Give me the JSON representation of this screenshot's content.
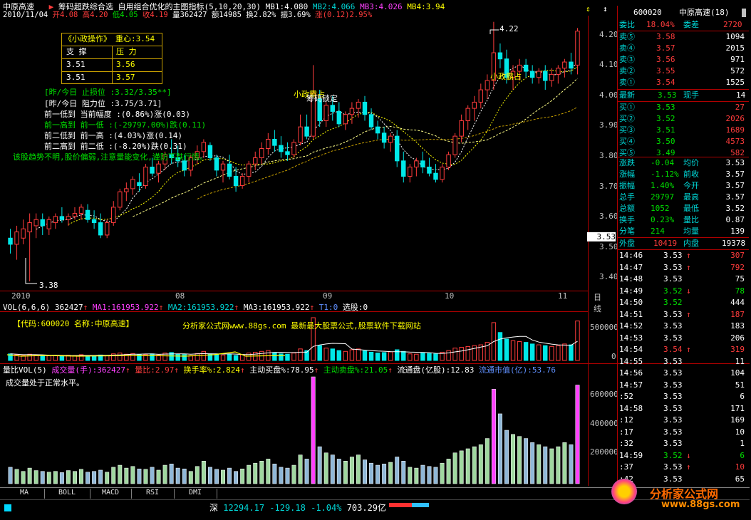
{
  "header": {
    "stock_name": "中原高速",
    "arrow": "▶",
    "formula_title": "筹码超跌综合选 自用组合优化的主图指标(5,10,20,30)",
    "mb1": "MB1:4.080",
    "mb2": "MB2:4.066",
    "mb3": "MB3:4.026",
    "mb4": "MB4:3.94",
    "date": "2010/11/04",
    "open": "开4.08",
    "high": "高4.20",
    "low": "低4.05",
    "close": "收4.19",
    "volume": "量362427",
    "amount": "额14985",
    "turnover": "换2.82%",
    "amplitude": "振3.69%",
    "change": "涨(0.12)2.95%"
  },
  "info_box": {
    "title": "《小政操作》",
    "center": "重心:3.54",
    "support_label": "支 撑",
    "pressure_label": "压 力",
    "support_1": "3.51",
    "pressure_1": "3.56",
    "support_2": "3.51",
    "pressure_2": "3.57"
  },
  "notes": {
    "stop_line": "[昨/今日 止损位 :3.32/3.35**]",
    "resist_line": "[昨/今日 阻力位 :3.75/3.71]",
    "l1": "前一低到 当前幅度 :(0.86%)涨(0.03)",
    "l2": "前一高到 前一低 :(-29797.00%)跌(0.11)",
    "l3": "前二低到 前一高 :(4.03%)涨(0.14)",
    "l4": "前二高到 前二低 :(-8.20%)跌(0.31)",
    "summary": "该股趋势不明,股价偏弱,注意量能变化,谨防下跌行情。",
    "tag_xiaozheng": "小政霸占",
    "tag_lock": "筹码锁定",
    "tag_xiaozheng2": "小政霸占",
    "max_price": "4.22",
    "min_price": "3.38"
  },
  "x_axis": {
    "m1": "2010",
    "m2": "08",
    "m3": "09",
    "m4": "10",
    "m5": "11",
    "period": "日线"
  },
  "y_axis": {
    "prices": [
      "4.20",
      "4.10",
      "4.00",
      "3.90",
      "3.80",
      "3.70",
      "3.60",
      "3.50",
      "3.40"
    ],
    "current": "3.53",
    "vol_ticks": [
      "500000",
      "0"
    ],
    "lb_ticks": [
      "600000",
      "400000",
      "200000"
    ]
  },
  "vol_header": {
    "name": "VOL(6,6,6)",
    "value": "362427",
    "ma1": "MA1:161953.922",
    "ma2": "MA2:161953.922",
    "ma3": "MA3:161953.922",
    "t1": "T1:0",
    "pick": "选股:0",
    "code_info": "【代码:600020 名称:中原高速】",
    "website": "分析家公式网www.88gs.com 最新最大股票公式,股票软件下载网站"
  },
  "lb_header": {
    "name": "量比VOL(5)",
    "vol": "成交量(手):362427",
    "lb": "量比:2.97",
    "hsl": "换手率%:2.824",
    "buy": "主动买盘%:78.95",
    "sell": "主动卖盘%:21.05",
    "float": "流通盘(亿股):12.83",
    "mkt": "流通市值(亿):53.76",
    "note": "成交量处于正常水平。"
  },
  "tabs": [
    "MA",
    "BOLL",
    "MACD",
    "RSI",
    "DMI"
  ],
  "status": {
    "market": "深",
    "index": "12294.17",
    "change": "-129.18",
    "pct": "-1.04%",
    "amount": "703.29亿",
    "logo_text": "分析家公式网",
    "logo_url": "www.88gs.com"
  },
  "order_book": {
    "code": "600020",
    "name": "中原高速(18)",
    "weibi_label": "委比",
    "weibi": "18.04%",
    "weicha_label": "委差",
    "weicha": "2720",
    "asks": [
      {
        "label": "卖⑤",
        "price": "3.58",
        "vol": "1094"
      },
      {
        "label": "卖④",
        "price": "3.57",
        "vol": "2015"
      },
      {
        "label": "卖③",
        "price": "3.56",
        "vol": "971"
      },
      {
        "label": "卖②",
        "price": "3.55",
        "vol": "572"
      },
      {
        "label": "卖①",
        "price": "3.54",
        "vol": "1525"
      }
    ],
    "last_label": "最新",
    "last": "3.53",
    "hand_label": "现手",
    "hand": "14",
    "bids": [
      {
        "label": "买①",
        "price": "3.53",
        "vol": "27"
      },
      {
        "label": "买②",
        "price": "3.52",
        "vol": "2026"
      },
      {
        "label": "买③",
        "price": "3.51",
        "vol": "1689"
      },
      {
        "label": "买④",
        "price": "3.50",
        "vol": "4573"
      },
      {
        "label": "买⑤",
        "price": "3.49",
        "vol": "582"
      }
    ],
    "stats": [
      {
        "l1": "涨跌",
        "v1": "-0.04",
        "l2": "均价",
        "v2": "3.53"
      },
      {
        "l1": "涨幅",
        "v1": "-1.12%",
        "l2": "前收",
        "v2": "3.57"
      },
      {
        "l1": "振幅",
        "v1": "1.40%",
        "l2": "今开",
        "v2": "3.57"
      },
      {
        "l1": "总手",
        "v1": "29797",
        "l2": "最高",
        "v2": "3.57"
      },
      {
        "l1": "总额",
        "v1": "1052",
        "l2": "最低",
        "v2": "3.52"
      },
      {
        "l1": "换手",
        "v1": "0.23%",
        "l2": "量比",
        "v2": "0.87"
      },
      {
        "l1": "分笔",
        "v1": "214",
        "l2": "均量",
        "v2": "139"
      }
    ],
    "outer_label": "外盘",
    "outer": "10419",
    "inner_label": "内盘",
    "inner": "19378",
    "ticks": [
      {
        "t": "14:46",
        "p": "3.53",
        "v": "307",
        "a": "↑"
      },
      {
        "t": "14:47",
        "p": "3.53",
        "v": "792",
        "a": "↑"
      },
      {
        "t": "14:48",
        "p": "3.53",
        "v": "75",
        "a": ""
      },
      {
        "t": "14:49",
        "p": "3.52",
        "v": "78",
        "a": "↓"
      },
      {
        "t": "14:50",
        "p": "3.52",
        "v": "444",
        "a": ""
      },
      {
        "t": "14:51",
        "p": "3.53",
        "v": "187",
        "a": "↑"
      },
      {
        "t": "14:52",
        "p": "3.53",
        "v": "183",
        "a": ""
      },
      {
        "t": "14:53",
        "p": "3.53",
        "v": "206",
        "a": ""
      },
      {
        "t": "14:54",
        "p": "3.54",
        "v": "319",
        "a": "↑"
      },
      {
        "t": "14:55",
        "p": "3.53",
        "v": "11",
        "a": ""
      },
      {
        "t": "14:56",
        "p": "3.53",
        "v": "104",
        "a": ""
      },
      {
        "t": "14:57",
        "p": "3.53",
        "v": "51",
        "a": ""
      },
      {
        "t": ":52",
        "p": "3.53",
        "v": "6",
        "a": ""
      },
      {
        "t": "14:58",
        "p": "3.53",
        "v": "171",
        "a": ""
      },
      {
        "t": ":12",
        "p": "3.53",
        "v": "169",
        "a": ""
      },
      {
        "t": ":17",
        "p": "3.53",
        "v": "10",
        "a": ""
      },
      {
        "t": ":32",
        "p": "3.53",
        "v": "1",
        "a": ""
      },
      {
        "t": "14:59",
        "p": "3.52",
        "v": "6",
        "a": "↓"
      },
      {
        "t": ":37",
        "p": "3.53",
        "v": "10",
        "a": "↑"
      },
      {
        "t": ":42",
        "p": "3.53",
        "v": "65",
        "a": ""
      }
    ]
  },
  "chart_data": {
    "type": "candlestick",
    "period": "daily",
    "ylim": [
      3.35,
      4.24
    ],
    "candles": [
      [
        3.52,
        3.55,
        3.47,
        3.5
      ],
      [
        3.5,
        3.56,
        3.45,
        3.54
      ],
      [
        3.52,
        3.58,
        3.5,
        3.55
      ],
      [
        3.54,
        3.6,
        3.38,
        3.57
      ],
      [
        3.56,
        3.6,
        3.52,
        3.58
      ],
      [
        3.58,
        3.6,
        3.53,
        3.56
      ],
      [
        3.55,
        3.59,
        3.53,
        3.58
      ],
      [
        3.57,
        3.6,
        3.55,
        3.59
      ],
      [
        3.59,
        3.62,
        3.57,
        3.58
      ],
      [
        3.58,
        3.6,
        3.56,
        3.59
      ],
      [
        3.59,
        3.62,
        3.58,
        3.6
      ],
      [
        3.6,
        3.63,
        3.58,
        3.62
      ],
      [
        3.61,
        3.63,
        3.57,
        3.58
      ],
      [
        3.58,
        3.61,
        3.55,
        3.57
      ],
      [
        3.57,
        3.6,
        3.52,
        3.53
      ],
      [
        3.53,
        3.58,
        3.52,
        3.57
      ],
      [
        3.57,
        3.64,
        3.56,
        3.62
      ],
      [
        3.62,
        3.68,
        3.61,
        3.67
      ],
      [
        3.67,
        3.7,
        3.64,
        3.68
      ],
      [
        3.68,
        3.72,
        3.66,
        3.71
      ],
      [
        3.7,
        3.73,
        3.67,
        3.69
      ],
      [
        3.69,
        3.76,
        3.68,
        3.75
      ],
      [
        3.75,
        3.78,
        3.72,
        3.73
      ],
      [
        3.73,
        3.77,
        3.7,
        3.76
      ],
      [
        3.76,
        3.8,
        3.74,
        3.79
      ],
      [
        3.79,
        3.84,
        3.76,
        3.78
      ],
      [
        3.78,
        3.82,
        3.75,
        3.77
      ],
      [
        3.77,
        3.79,
        3.72,
        3.74
      ],
      [
        3.74,
        3.79,
        3.72,
        3.78
      ],
      [
        3.78,
        3.82,
        3.76,
        3.8
      ],
      [
        3.8,
        3.84,
        3.78,
        3.83
      ],
      [
        3.82,
        3.83,
        3.77,
        3.78
      ],
      [
        3.78,
        3.79,
        3.72,
        3.74
      ],
      [
        3.74,
        3.77,
        3.7,
        3.76
      ],
      [
        3.76,
        3.79,
        3.71,
        3.72
      ],
      [
        3.72,
        3.75,
        3.67,
        3.69
      ],
      [
        3.69,
        3.73,
        3.68,
        3.72
      ],
      [
        3.72,
        3.77,
        3.7,
        3.76
      ],
      [
        3.76,
        3.8,
        3.74,
        3.78
      ],
      [
        3.78,
        3.83,
        3.76,
        3.81
      ],
      [
        3.81,
        3.86,
        3.79,
        3.84
      ],
      [
        3.84,
        3.87,
        3.8,
        3.82
      ],
      [
        3.82,
        3.85,
        3.78,
        3.8
      ],
      [
        3.8,
        3.83,
        3.77,
        3.79
      ],
      [
        3.79,
        3.84,
        3.78,
        3.83
      ],
      [
        3.83,
        3.92,
        3.82,
        3.88
      ],
      [
        3.88,
        3.92,
        3.84,
        3.85
      ],
      [
        3.85,
        4.08,
        3.84,
        3.99
      ],
      [
        3.97,
        4.0,
        3.88,
        3.9
      ],
      [
        3.9,
        3.96,
        3.88,
        3.95
      ],
      [
        3.95,
        3.98,
        3.9,
        3.93
      ],
      [
        3.93,
        3.96,
        3.88,
        3.89
      ],
      [
        3.89,
        3.93,
        3.87,
        3.92
      ],
      [
        3.92,
        3.96,
        3.89,
        3.94
      ],
      [
        3.94,
        3.97,
        3.91,
        3.96
      ],
      [
        3.96,
        3.98,
        3.9,
        3.92
      ],
      [
        3.92,
        3.94,
        3.87,
        3.88
      ],
      [
        3.88,
        3.9,
        3.84,
        3.86
      ],
      [
        3.86,
        3.88,
        3.81,
        3.83
      ],
      [
        3.83,
        3.86,
        3.8,
        3.85
      ],
      [
        3.85,
        3.87,
        3.75,
        3.77
      ],
      [
        3.77,
        3.8,
        3.7,
        3.72
      ],
      [
        3.72,
        3.76,
        3.7,
        3.75
      ],
      [
        3.75,
        3.78,
        3.72,
        3.77
      ],
      [
        3.77,
        3.8,
        3.73,
        3.75
      ],
      [
        3.75,
        3.78,
        3.72,
        3.73
      ],
      [
        3.73,
        3.76,
        3.7,
        3.71
      ],
      [
        3.71,
        3.76,
        3.7,
        3.75
      ],
      [
        3.75,
        3.8,
        3.74,
        3.79
      ],
      [
        3.79,
        3.86,
        3.78,
        3.85
      ],
      [
        3.85,
        3.92,
        3.83,
        3.9
      ],
      [
        3.9,
        3.95,
        3.87,
        3.94
      ],
      [
        3.94,
        3.98,
        3.9,
        3.96
      ],
      [
        3.96,
        4.02,
        3.94,
        4.0
      ],
      [
        4.0,
        4.05,
        3.97,
        4.03
      ],
      [
        4.03,
        4.22,
        4.0,
        4.12
      ],
      [
        4.12,
        4.15,
        4.07,
        4.1
      ],
      [
        4.1,
        4.13,
        4.02,
        4.04
      ],
      [
        4.04,
        4.08,
        4.0,
        4.06
      ],
      [
        4.06,
        4.1,
        4.03,
        4.08
      ],
      [
        4.08,
        4.1,
        4.04,
        4.06
      ],
      [
        4.06,
        4.08,
        4.02,
        4.04
      ],
      [
        4.04,
        4.07,
        4.02,
        4.06
      ],
      [
        4.06,
        4.08,
        4.0,
        4.03
      ],
      [
        4.03,
        4.07,
        4.01,
        4.05
      ],
      [
        4.05,
        4.08,
        4.02,
        4.07
      ],
      [
        4.07,
        4.1,
        4.04,
        4.09
      ],
      [
        4.09,
        4.12,
        4.05,
        4.07
      ],
      [
        4.08,
        4.2,
        4.05,
        4.19
      ]
    ],
    "volumes": [
      40,
      35,
      30,
      38,
      32,
      30,
      28,
      30,
      27,
      32,
      30,
      35,
      28,
      30,
      33,
      28,
      40,
      45,
      38,
      42,
      36,
      35,
      40,
      33,
      45,
      48,
      38,
      36,
      30,
      42,
      55,
      40,
      35,
      33,
      38,
      30,
      36,
      45,
      50,
      55,
      60,
      48,
      40,
      38,
      45,
      70,
      60,
      260,
      90,
      75,
      70,
      60,
      55,
      65,
      70,
      58,
      50,
      45,
      48,
      52,
      65,
      55,
      40,
      38,
      45,
      42,
      40,
      50,
      60,
      75,
      80,
      85,
      90,
      95,
      110,
      230,
      170,
      130,
      120,
      115,
      110,
      100,
      95,
      90,
      85,
      90,
      100,
      95,
      240
    ]
  }
}
